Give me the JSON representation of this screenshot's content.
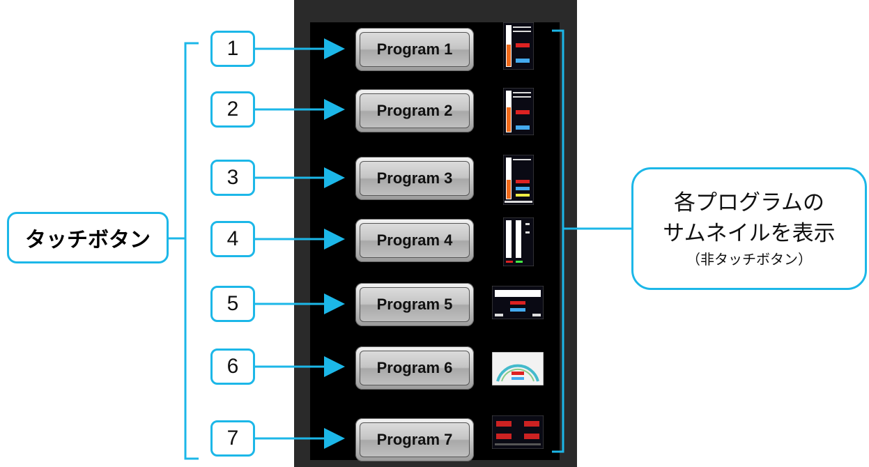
{
  "left_label": "タッチボタン",
  "right_label": {
    "line1": "各プログラム",
    "line1b": "の",
    "line2": "サムネイルを表示",
    "line3": "（非タッチボタン）"
  },
  "programs": [
    {
      "number": "1",
      "label": "Program 1"
    },
    {
      "number": "2",
      "label": "Program 2"
    },
    {
      "number": "3",
      "label": "Program 3"
    },
    {
      "number": "4",
      "label": "Program 4"
    },
    {
      "number": "5",
      "label": "Program 5"
    },
    {
      "number": "6",
      "label": "Program 6"
    },
    {
      "number": "7",
      "label": "Program 7"
    }
  ],
  "colors": {
    "accent": "#1cb7e8",
    "panel": "#2a2a2a",
    "screen": "#000000"
  }
}
